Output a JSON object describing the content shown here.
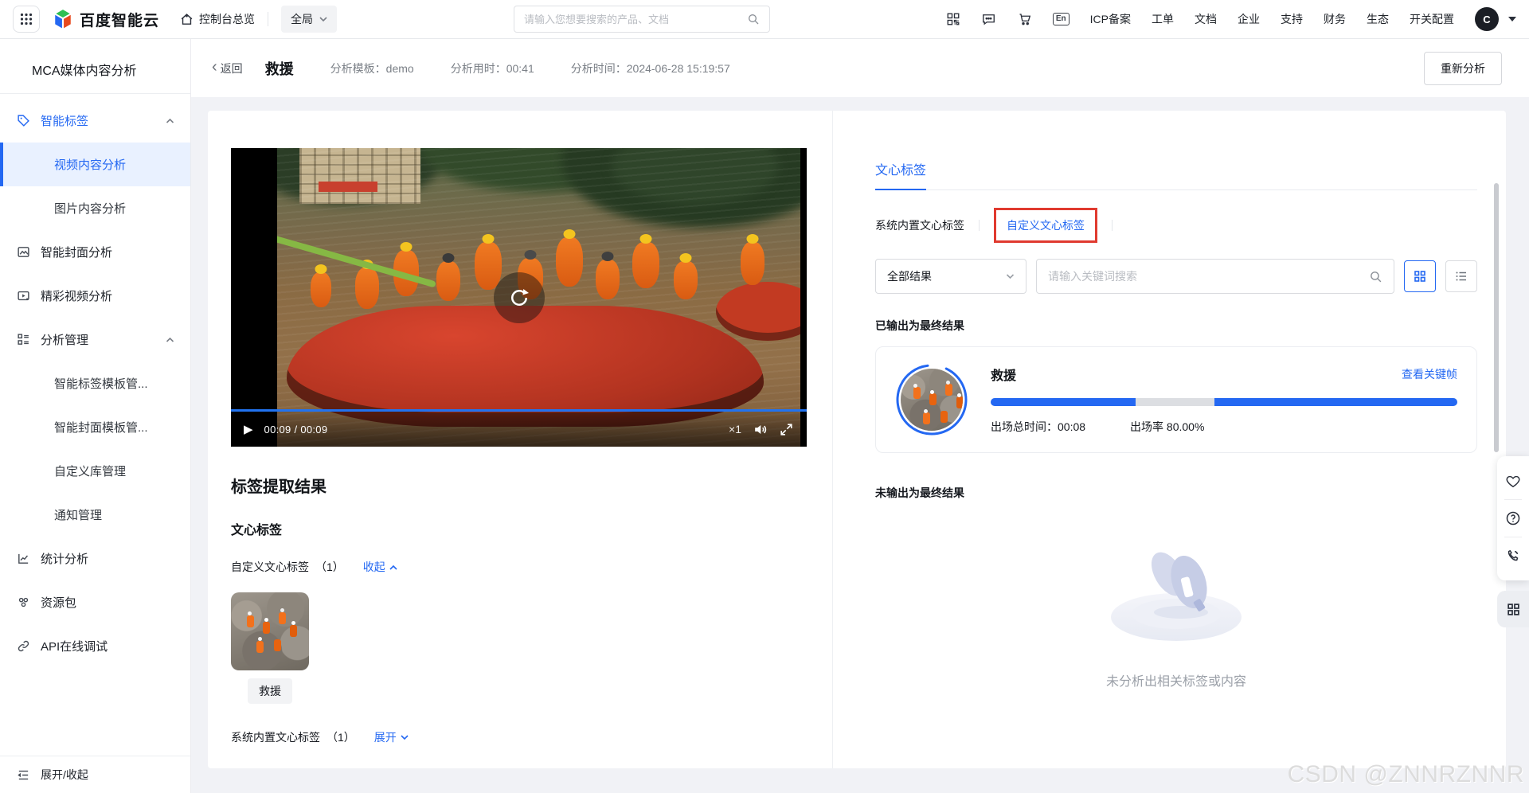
{
  "topbar": {
    "brand": "百度智能云",
    "console": "控制台总览",
    "scope": "全局",
    "search_placeholder": "请输入您想要搜索的产品、文档",
    "en_badge": "En",
    "links": [
      "ICP备案",
      "工单",
      "文档",
      "企业",
      "支持",
      "财务",
      "生态",
      "开关配置"
    ],
    "avatar": "C"
  },
  "sidebar": {
    "title": "MCA媒体内容分析",
    "items": [
      {
        "label": "智能标签"
      },
      {
        "label": "视频内容分析"
      },
      {
        "label": "图片内容分析"
      },
      {
        "label": "智能封面分析"
      },
      {
        "label": "精彩视频分析"
      },
      {
        "label": "分析管理"
      },
      {
        "label": "智能标签模板管..."
      },
      {
        "label": "智能封面模板管..."
      },
      {
        "label": "自定义库管理"
      },
      {
        "label": "通知管理"
      },
      {
        "label": "统计分析"
      },
      {
        "label": "资源包"
      },
      {
        "label": "API在线调试"
      }
    ],
    "footer": "展开/收起"
  },
  "page_header": {
    "back": "返回",
    "title": "救援",
    "template": "分析模板：demo",
    "duration": "分析用时：00:41",
    "time": "分析时间：2024-06-28 15:19:57",
    "reanalyze": "重新分析"
  },
  "player": {
    "time_display": "00:09 / 00:09",
    "speed": "×1"
  },
  "extract": {
    "heading": "标签提取结果",
    "group": "文心标签",
    "custom_label": "自定义文心标签",
    "custom_count": "（1）",
    "collapse": "收起",
    "chip": "救援",
    "system_label": "系统内置文心标签",
    "system_count": "（1）",
    "expand": "展开"
  },
  "right_panel": {
    "tab": "文心标签",
    "subtab_system": "系统内置文心标签",
    "subtab_custom": "自定义文心标签",
    "filter": "全部结果",
    "search_placeholder": "请输入关键词搜索",
    "final_heading": "已输出为最终结果",
    "result": {
      "title": "救援",
      "link": "查看关键帧",
      "duration": "出场总时间：00:08",
      "rate": "出场率 80.00%",
      "timeline": [
        {
          "on": true,
          "pct": 31
        },
        {
          "on": false,
          "pct": 17
        },
        {
          "on": true,
          "pct": 52
        }
      ]
    },
    "not_final_heading": "未输出为最终结果",
    "empty_text": "未分析出相关标签或内容"
  },
  "glyphs": {
    "back": "‹",
    "play": "▶"
  },
  "colors": {
    "accent": "#2468f2",
    "annotation_red": "#e03a2f",
    "progress_off": "#dcdee2"
  },
  "watermark": "CSDN @ZNNRZNNR"
}
